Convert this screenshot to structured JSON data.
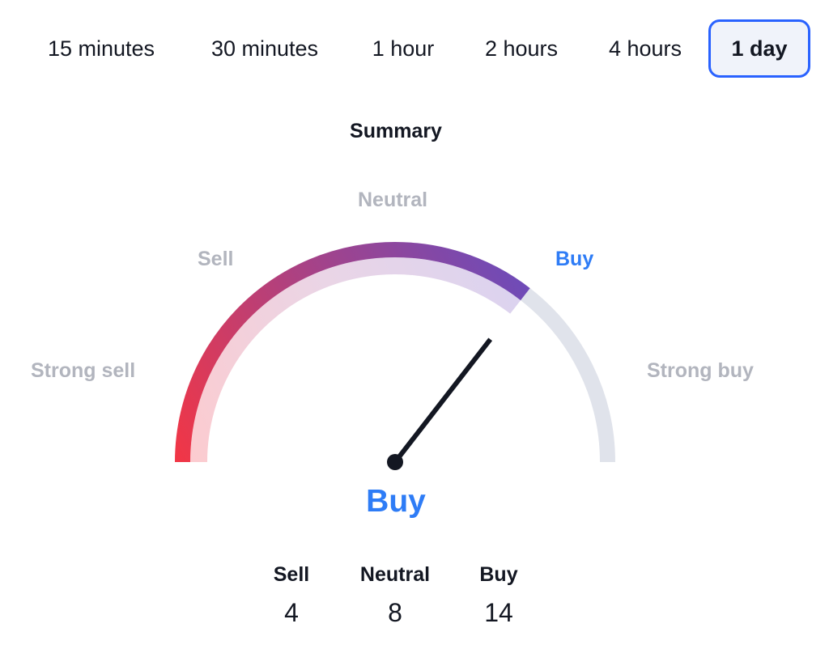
{
  "tabs": [
    {
      "label": "15 minutes",
      "active": false
    },
    {
      "label": "30 minutes",
      "active": false
    },
    {
      "label": "1 hour",
      "active": false
    },
    {
      "label": "2 hours",
      "active": false
    },
    {
      "label": "4 hours",
      "active": false
    },
    {
      "label": "1 day",
      "active": true
    }
  ],
  "summary": {
    "title": "Summary",
    "gauge_labels": {
      "strong_sell": "Strong sell",
      "sell": "Sell",
      "neutral": "Neutral",
      "buy": "Buy",
      "strong_buy": "Strong buy"
    },
    "active_label": "buy",
    "gauge_value_fraction": 0.71,
    "result": "Buy",
    "counts": [
      {
        "label": "Sell",
        "value": "4"
      },
      {
        "label": "Neutral",
        "value": "8"
      },
      {
        "label": "Buy",
        "value": "14"
      }
    ],
    "colors": {
      "accent": "#2962ff",
      "buy": "#2e7cf6",
      "gradient_start": "#f23645",
      "gradient_mid": "#a2438b",
      "gradient_end": "#6a4cbc",
      "track": "#e0e3eb",
      "muted_label": "#b2b5be",
      "needle": "#131722"
    }
  }
}
